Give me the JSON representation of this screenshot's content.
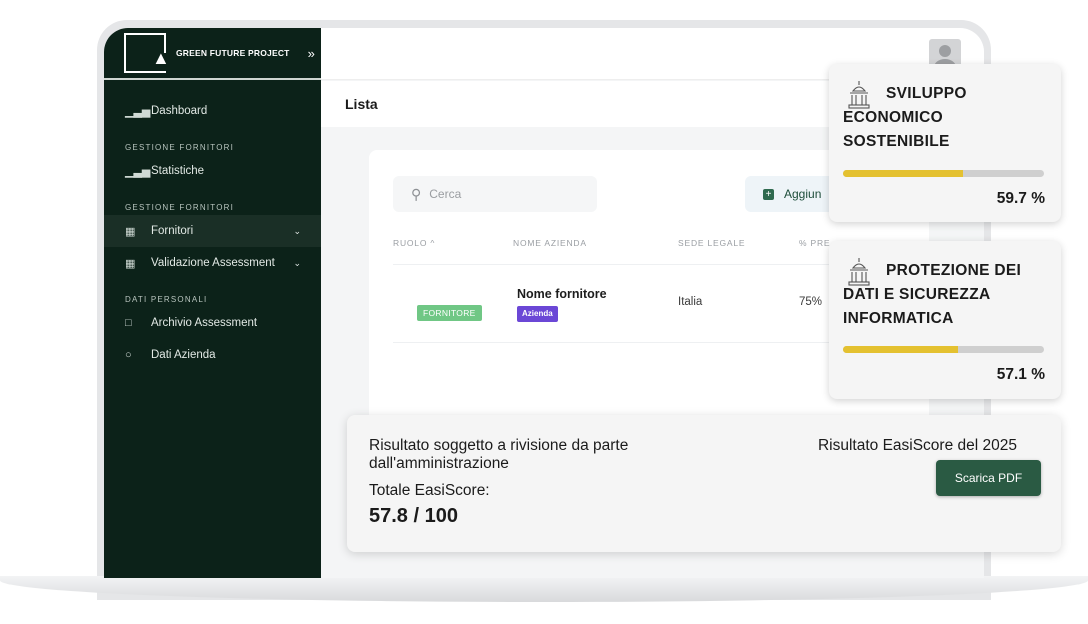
{
  "brand": {
    "name": "GREEN FUTURE PROJECT",
    "toggle_icon": "double-chevron-right-icon"
  },
  "sidebar": {
    "items": [
      {
        "type": "item",
        "label": "Dashboard",
        "icon": "bar-chart-icon"
      },
      {
        "type": "section",
        "label": "GESTIONE FORNITORI"
      },
      {
        "type": "item",
        "label": "Statistiche",
        "icon": "bar-chart-icon"
      },
      {
        "type": "section",
        "label": "GESTIONE FORNITORI"
      },
      {
        "type": "item",
        "label": "Fornitori",
        "icon": "supplier-icon",
        "active": true,
        "chevron": true
      },
      {
        "type": "item",
        "label": "Validazione Assessment",
        "icon": "validation-icon",
        "chevron": true
      },
      {
        "type": "section",
        "label": "DATI PERSONALI"
      },
      {
        "type": "item",
        "label": "Archivio Assessment",
        "icon": "folder-icon"
      },
      {
        "type": "item",
        "label": "Dati Azienda",
        "icon": "company-icon"
      }
    ]
  },
  "header": {
    "title": "Lista"
  },
  "search": {
    "placeholder": "Cerca"
  },
  "toolbar": {
    "add_label": "Aggiun"
  },
  "table": {
    "columns": [
      "RUOLO ^",
      "NOME AZIENDA",
      "SEDE LEGALE",
      "% PRE"
    ],
    "rows": [
      {
        "role": "FORNITORE",
        "name": "Nome fornitore",
        "type": "Azienda",
        "sede": "Italia",
        "percent": "75%"
      }
    ]
  },
  "score_cards": [
    {
      "title": "SVILUPPO ECONOMICO SOSTENIBILE",
      "value": "59.7 %",
      "progress": 0.597,
      "icon": "government-building-icon"
    },
    {
      "title": "PROTEZIONE DEI DATI E SICUREZZA INFORMATICA",
      "value": "57.1 %",
      "progress": 0.571,
      "icon": "government-building-icon"
    }
  ],
  "result": {
    "review_note": "Risultato soggetto a rivisione da parte dall'amministrazione",
    "total_label": "Totale EasiScore:",
    "total_value": "57.8 / 100",
    "year_label": "Risultato EasiScore del 2025",
    "pdf_label": "Scarica PDF"
  },
  "colors": {
    "sidebar_bg": "#0c2219",
    "accent_green": "#2a5a43",
    "progress_yellow": "#e4c130",
    "role_tag": "#70c785",
    "type_tag": "#6b47d6"
  }
}
